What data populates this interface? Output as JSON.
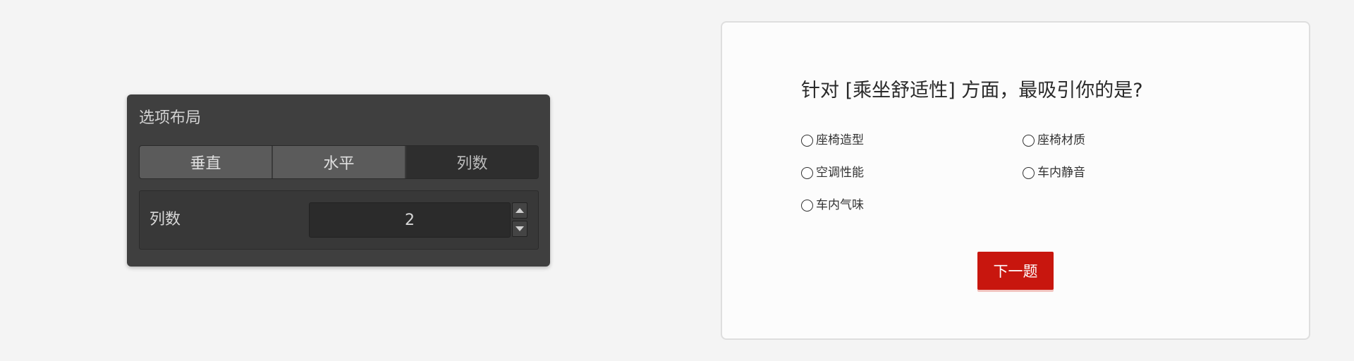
{
  "layout_panel": {
    "title": "选项布局",
    "segments": [
      "垂直",
      "水平",
      "列数"
    ],
    "columns_label": "列数",
    "columns_value": "2"
  },
  "question": {
    "title": "针对 [乘坐舒适性] 方面，最吸引你的是?",
    "options": [
      "座椅造型",
      "座椅材质",
      "空调性能",
      "车内静音",
      "车内气味"
    ],
    "next_label": "下一题"
  },
  "colors": {
    "panel_bg": "#3f3f3f",
    "accent_red": "#c8160e",
    "page_bg": "#f4f4f4"
  }
}
